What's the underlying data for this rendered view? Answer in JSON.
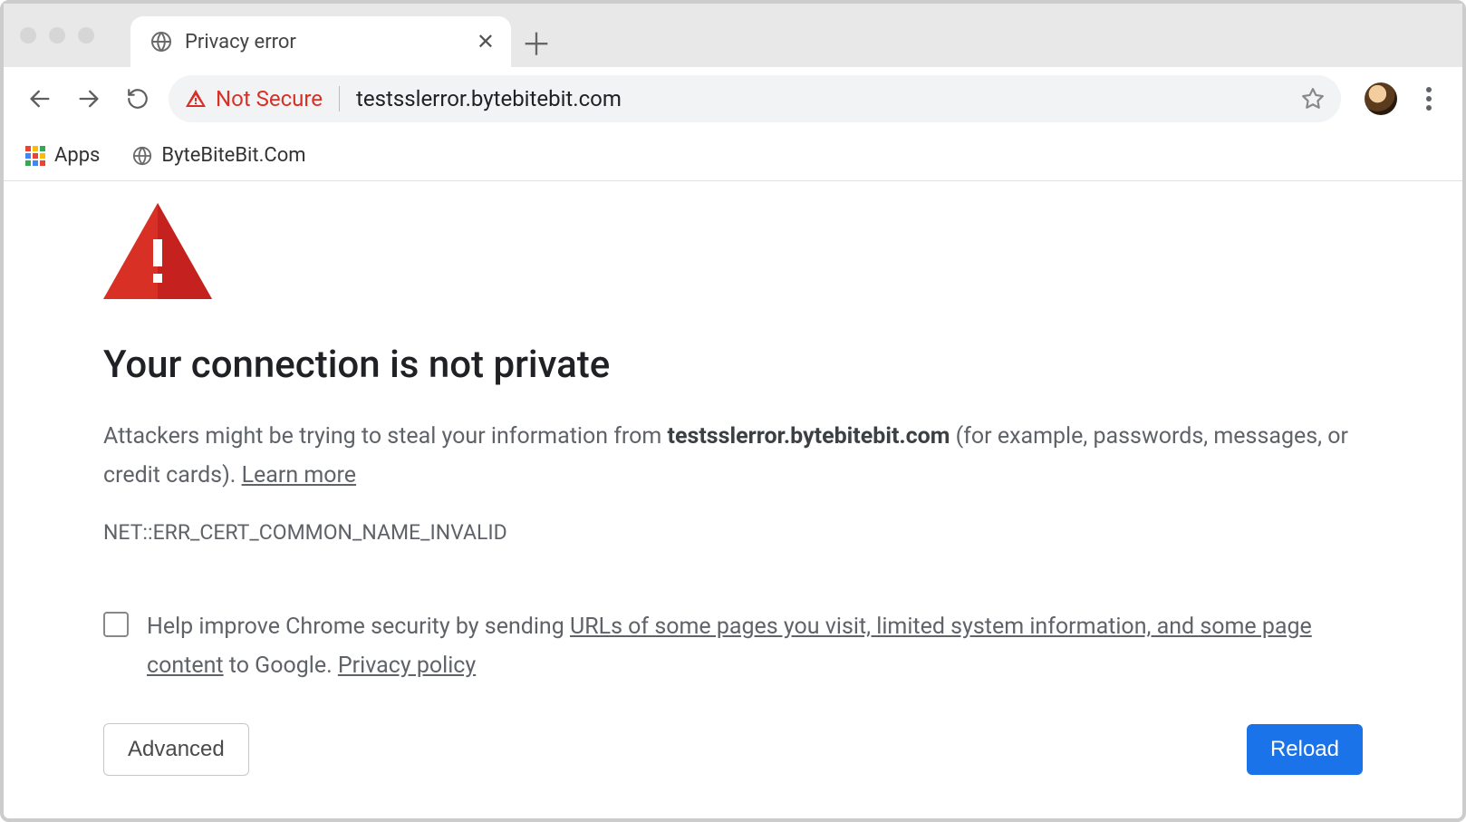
{
  "window": {
    "tab_title": "Privacy error"
  },
  "toolbar": {
    "security_label": "Not Secure",
    "url": "testsslerror.bytebitebit.com"
  },
  "bookmarks": {
    "apps_label": "Apps",
    "items": [
      {
        "label": "ByteBiteBit.Com"
      }
    ]
  },
  "interstitial": {
    "heading": "Your connection is not private",
    "paragraph_prefix": "Attackers might be trying to steal your information from ",
    "domain_bold": "testsslerror.bytebitebit.com",
    "paragraph_suffix": " (for example, passwords, messages, or credit cards). ",
    "learn_more": "Learn more",
    "error_code": "NET::ERR_CERT_COMMON_NAME_INVALID",
    "optin_prefix": "Help improve Chrome security by sending ",
    "optin_link": "URLs of some pages you visit, limited system information, and some page content",
    "optin_mid": " to Google. ",
    "privacy_policy": "Privacy policy",
    "advanced_label": "Advanced",
    "reload_label": "Reload"
  }
}
